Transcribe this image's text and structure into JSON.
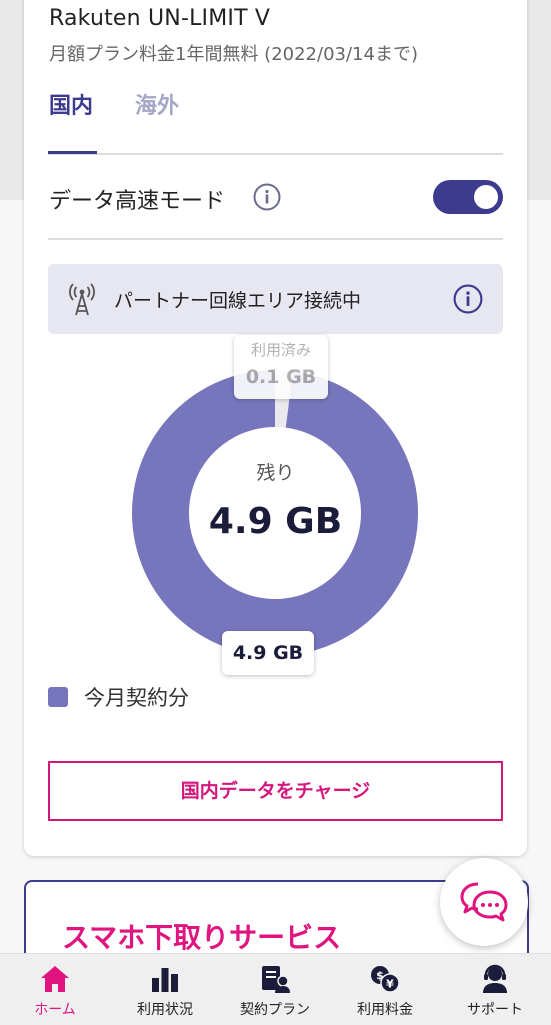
{
  "plan": {
    "name": "Rakuten UN-LIMIT V",
    "note": "月額プラン料金1年間無料 (2022/03/14まで)"
  },
  "tabs": [
    {
      "label": "国内",
      "active": true
    },
    {
      "label": "海外",
      "active": false
    }
  ],
  "data_mode": {
    "label": "データ高速モード",
    "enabled": true,
    "info_icon": "info-icon"
  },
  "network_banner": {
    "text": "パートナー回線エリア接続中",
    "icon": "antenna-icon",
    "info_icon": "info-icon"
  },
  "usage": {
    "used_label": "利用済み",
    "used_value": "0.1 GB",
    "remaining_label": "残り",
    "remaining_value": "4.9 GB",
    "remaining_tag": "4.9 GB",
    "used_gb": 0.1,
    "remaining_gb": 4.9
  },
  "legend": {
    "label": "今月契約分",
    "color": "#7776bd"
  },
  "charge_button": {
    "label": "国内データをチャージ"
  },
  "promo_card": {
    "title": "スマホ下取りサービス"
  },
  "chat_button": {
    "icon": "chat-icon"
  },
  "bottom_nav": [
    {
      "label": "ホーム",
      "icon": "home-icon",
      "active": true
    },
    {
      "label": "利用状況",
      "icon": "bar-chart-icon",
      "active": false
    },
    {
      "label": "契約プラン",
      "icon": "contract-plan-icon",
      "active": false
    },
    {
      "label": "利用料金",
      "icon": "fee-icon",
      "active": false
    },
    {
      "label": "サポート",
      "icon": "support-icon",
      "active": false
    }
  ],
  "colors": {
    "primary": "#3d3b8e",
    "accent": "#e0137f",
    "donut": "#7776bd",
    "used": "#e9e9ee"
  }
}
